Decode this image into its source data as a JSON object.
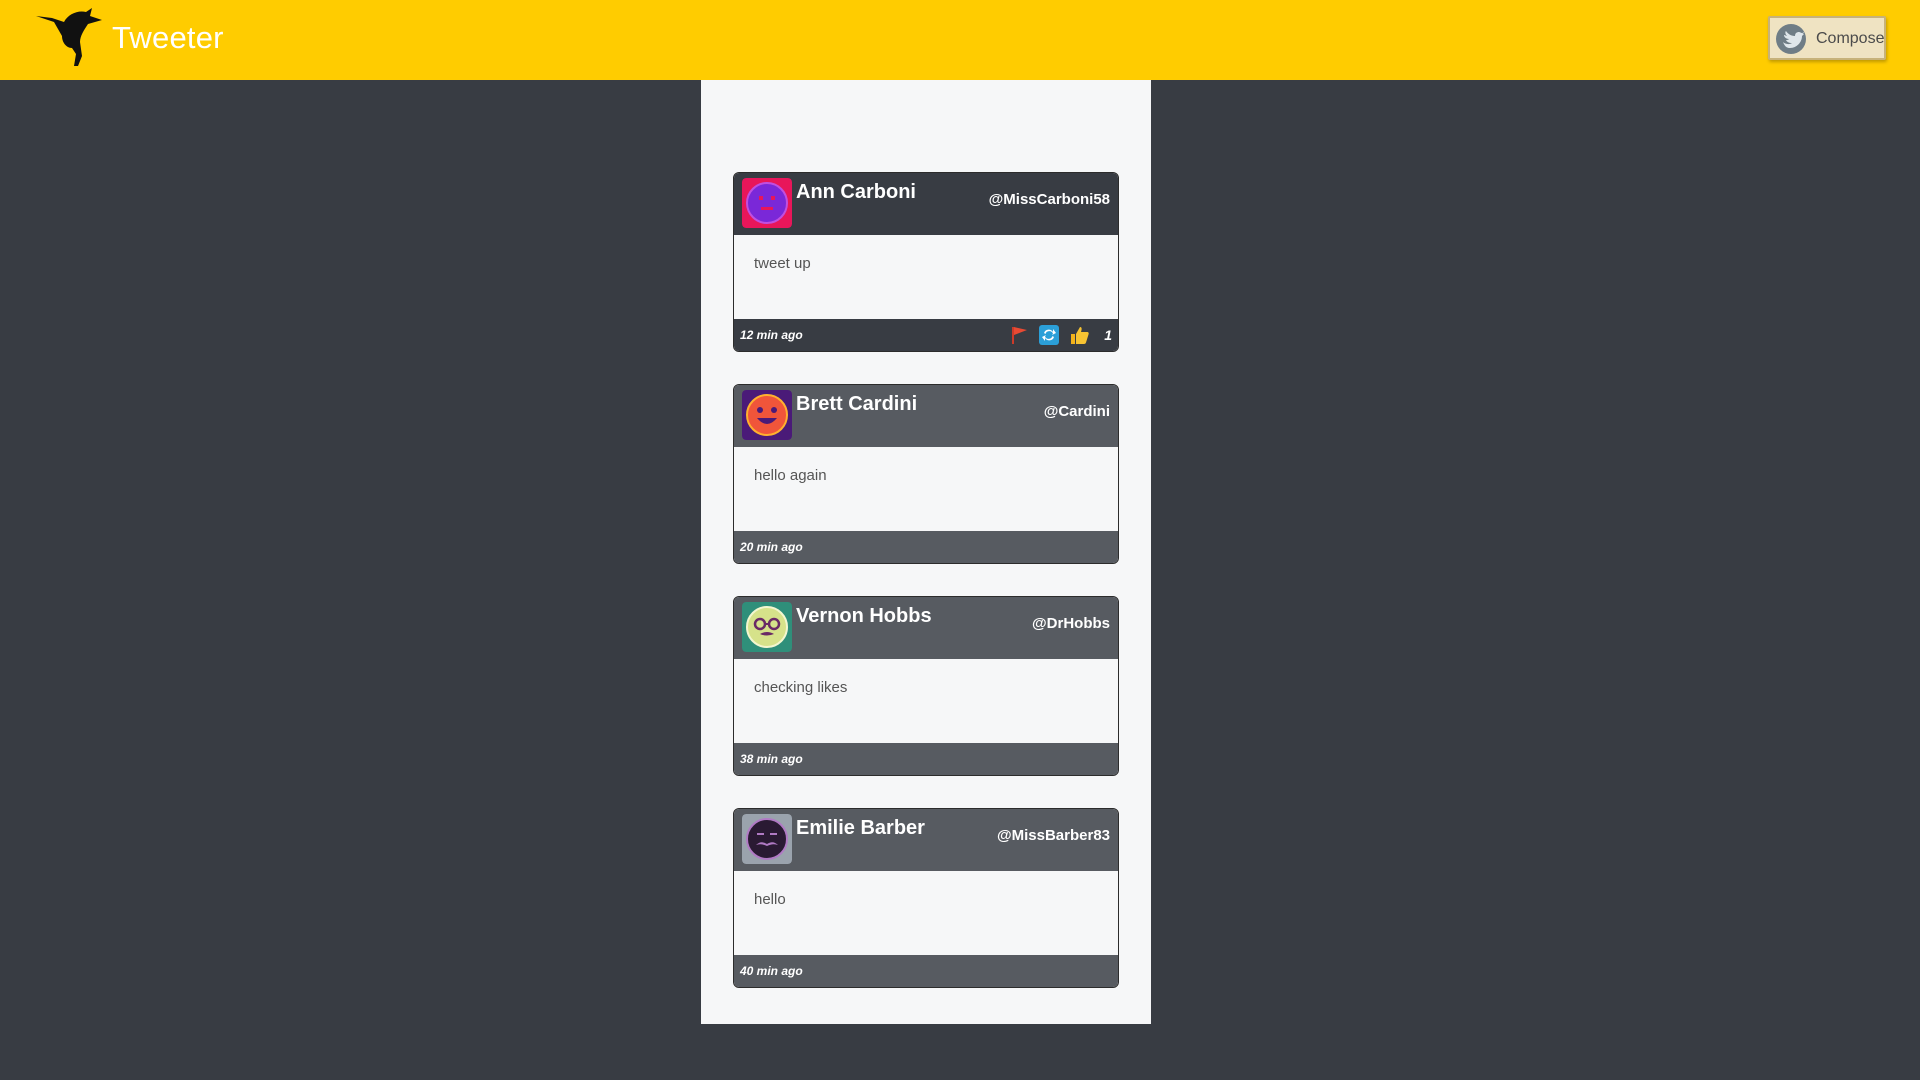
{
  "header": {
    "brand": "Tweeter",
    "compose_label": "Compose",
    "brand_color": "#ffcc00"
  },
  "tweets": [
    {
      "author": "Ann Carboni",
      "handle": "@MissCarboni58",
      "text": "tweet up",
      "time": "12 min ago",
      "likes": "1",
      "avatar_icon": "smiley-face-icon",
      "avatar_bg": "#e8165a",
      "avatar_face": "#7a28d8",
      "actions": [
        "flag-icon",
        "retweet-icon",
        "like-icon"
      ]
    },
    {
      "author": "Brett Cardini",
      "handle": "@Cardini",
      "text": "hello again",
      "time": "20 min ago",
      "avatar_icon": "happy-face-icon",
      "avatar_bg": "#4a1a78",
      "avatar_face": "#f0553a"
    },
    {
      "author": "Vernon Hobbs",
      "handle": "@DrHobbs",
      "text": "checking likes",
      "time": "38 min ago",
      "avatar_icon": "glasses-face-icon",
      "avatar_bg": "#2f8f7a",
      "avatar_face": "#d6e28a"
    },
    {
      "author": "Emilie Barber",
      "handle": "@MissBarber83",
      "text": "hello",
      "time": "40 min ago",
      "avatar_icon": "mustache-face-icon",
      "avatar_bg": "#9aa3ad",
      "avatar_face": "#2a1a33"
    }
  ]
}
